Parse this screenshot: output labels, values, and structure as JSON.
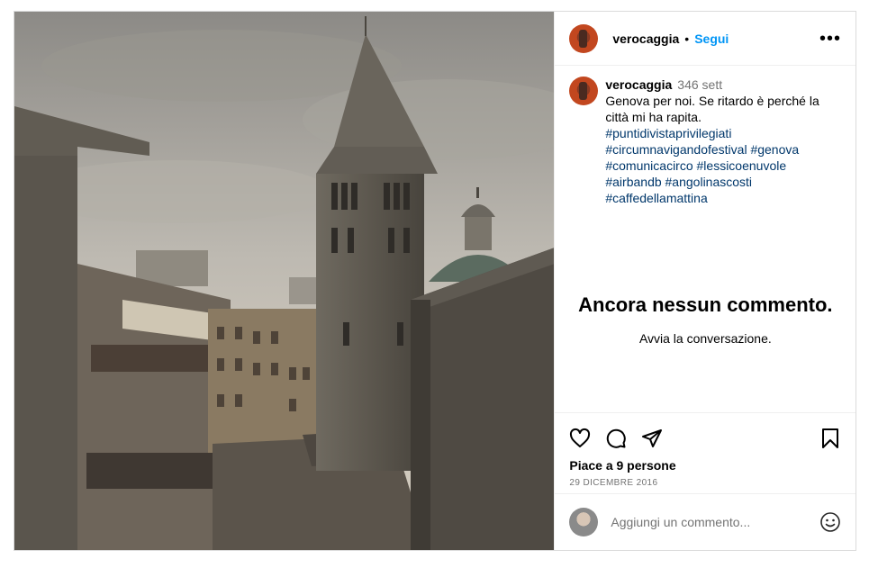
{
  "post": {
    "username": "verocaggia",
    "follow_label": "Segui",
    "separator": "•",
    "more_label": "•••",
    "caption_time": "346 sett",
    "caption_text": "Genova per noi. Se ritardo è perché la città mi ha rapita.",
    "hashtags": [
      "#puntidivistaprivilegiati",
      "#circumnavigandofestival #genova",
      "#comunicacirco #lessicoenuvole",
      "#airbandb #angolinascosti",
      "#caffedellamattina"
    ],
    "no_comments_title": "Ancora nessun commento.",
    "no_comments_sub": "Avvia la conversazione.",
    "likes": "Piace a 9 persone",
    "date": "29 DICEMBRE 2016",
    "comment_placeholder": "Aggiungi un commento..."
  },
  "icons": [
    "heart-icon",
    "comment-icon",
    "share-icon",
    "bookmark-icon",
    "emoji-icon",
    "more-icon"
  ]
}
